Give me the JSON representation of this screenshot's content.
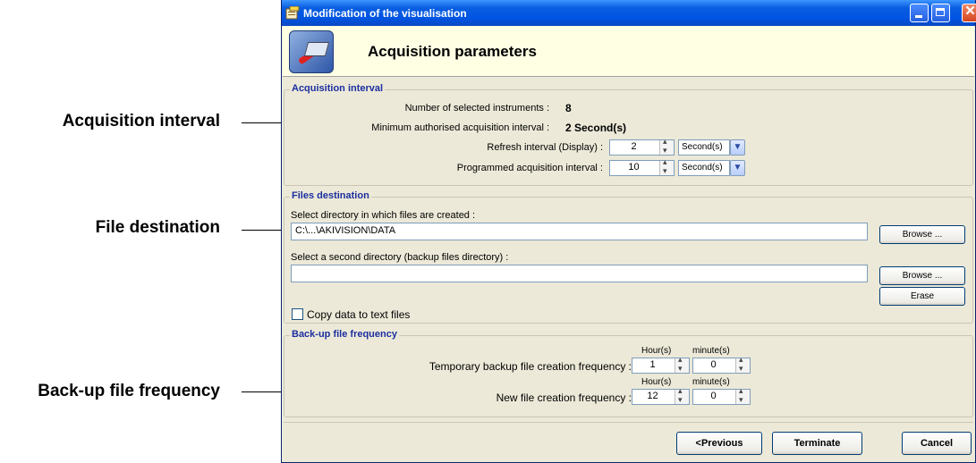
{
  "callouts": [
    {
      "label": "Acquisition interval"
    },
    {
      "label": "File destination"
    },
    {
      "label": "Back-up file frequency"
    }
  ],
  "window": {
    "title": "Modification of the visualisation",
    "header_title": "Acquisition parameters"
  },
  "acquisition": {
    "legend": "Acquisition interval",
    "instruments_label": "Number of selected instruments :",
    "instruments_value": "8",
    "min_label": "Minimum authorised acquisition interval :",
    "min_value": "2 Second(s)",
    "refresh_label": "Refresh interval (Display) :",
    "refresh_value": "2",
    "refresh_unit": "Second(s)",
    "programmed_label": "Programmed acquisition interval :",
    "programmed_value": "10",
    "programmed_unit": "Second(s)"
  },
  "files": {
    "legend": "Files destination",
    "dir_label": "Select directory in which files are created :",
    "dir_value": "C:\\...\\AKIVISION\\DATA",
    "browse_label": "Browse ...",
    "second_label": "Select a second directory (backup files directory) :",
    "second_value": "",
    "browse2_label": "Browse ...",
    "erase_label": "Erase",
    "copy_label": "Copy data to text files"
  },
  "backup": {
    "legend": "Back-up file frequency",
    "hours_header": "Hour(s)",
    "minutes_header": "minute(s)",
    "temp_label": "Temporary backup file creation frequency :",
    "temp_hours": "1",
    "temp_minutes": "0",
    "new_label": "New file creation frequency :",
    "new_hours": "12",
    "new_minutes": "0"
  },
  "footer": {
    "previous_label": "<Previous",
    "terminate_label": "Terminate",
    "cancel_label": "Cancel"
  }
}
